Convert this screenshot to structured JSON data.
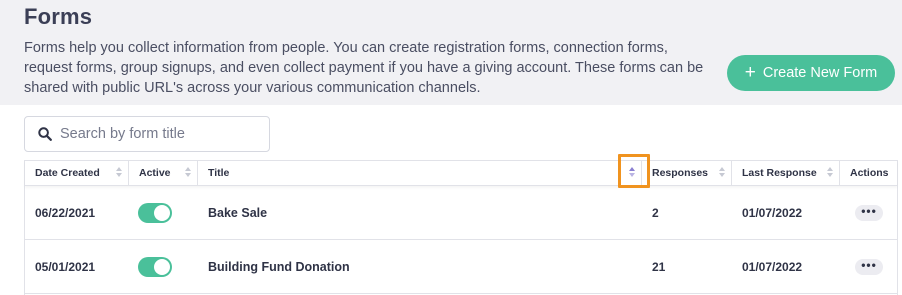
{
  "header": {
    "title": "Forms",
    "description": "Forms help you collect information from people. You can create registration forms, connection forms, request forms, group signups, and even collect payment if you have a giving account. These forms can be shared with public URL's across your various communication channels.",
    "create_button_label": "Create New Form",
    "create_button_icon": "plus-icon"
  },
  "search": {
    "placeholder": "Search by form title",
    "value": "",
    "icon": "search-icon"
  },
  "table": {
    "columns": [
      {
        "label": "Date Created",
        "sortable": true
      },
      {
        "label": "Active",
        "sortable": true
      },
      {
        "label": "Title",
        "sortable": true,
        "sort_active": true
      },
      {
        "label": "Responses",
        "sortable": true
      },
      {
        "label": "Last Response",
        "sortable": true
      },
      {
        "label": "Actions",
        "sortable": false
      }
    ],
    "rows": [
      {
        "date_created": "06/22/2021",
        "active": true,
        "title": "Bake Sale",
        "responses": "2",
        "last_response": "01/07/2022",
        "actions_label": "•••"
      },
      {
        "date_created": "05/01/2021",
        "active": true,
        "title": "Building Fund Donation",
        "responses": "21",
        "last_response": "01/07/2022",
        "actions_label": "•••"
      }
    ]
  },
  "colors": {
    "accent_green": "#4ac09a",
    "highlight_orange": "#f0931f",
    "header_bg": "#f1f1f4",
    "sort_active": "#8a7fd1"
  }
}
